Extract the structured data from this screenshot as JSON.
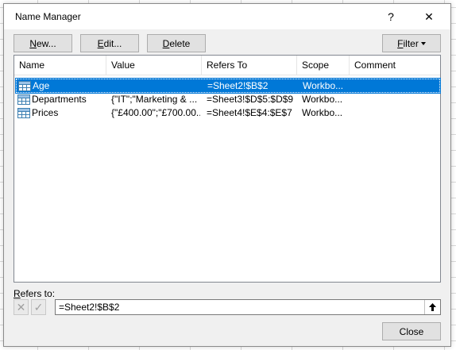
{
  "dialog": {
    "title": "Name Manager",
    "help_glyph": "?",
    "close_glyph": "✕"
  },
  "toolbar": {
    "new_prefix": "",
    "new_mnemonic": "N",
    "new_suffix": "ew...",
    "edit_prefix": "",
    "edit_mnemonic": "E",
    "edit_suffix": "dit...",
    "delete_prefix": "",
    "delete_mnemonic": "D",
    "delete_suffix": "elete",
    "filter_prefix": "",
    "filter_mnemonic": "F",
    "filter_suffix": "ilter"
  },
  "list": {
    "columns": [
      "Name",
      "Value",
      "Refers To",
      "Scope",
      "Comment"
    ],
    "rows": [
      {
        "name": "Age",
        "value": "",
        "refers_to": "=Sheet2!$B$2",
        "scope": "Workbo...",
        "comment": "",
        "selected": true
      },
      {
        "name": "Departments",
        "value": "{\"IT\";\"Marketing & ...",
        "refers_to": "=Sheet3!$D$5:$D$9",
        "scope": "Workbo...",
        "comment": ""
      },
      {
        "name": "Prices",
        "value": "{\"£400.00\";\"£700.00...",
        "refers_to": "=Sheet4!$E$4:$E$7",
        "scope": "Workbo...",
        "comment": ""
      }
    ]
  },
  "refers": {
    "label_mnemonic": "R",
    "label_rest": "efers to:",
    "value": "=Sheet2!$B$2",
    "cancel_glyph": "✕",
    "confirm_glyph": "✓"
  },
  "footer": {
    "close_label": "Close"
  },
  "colors": {
    "selection": "#0078d7",
    "dialog_bg": "#f0f0f0",
    "icon_blue": "#3c7fb1"
  }
}
